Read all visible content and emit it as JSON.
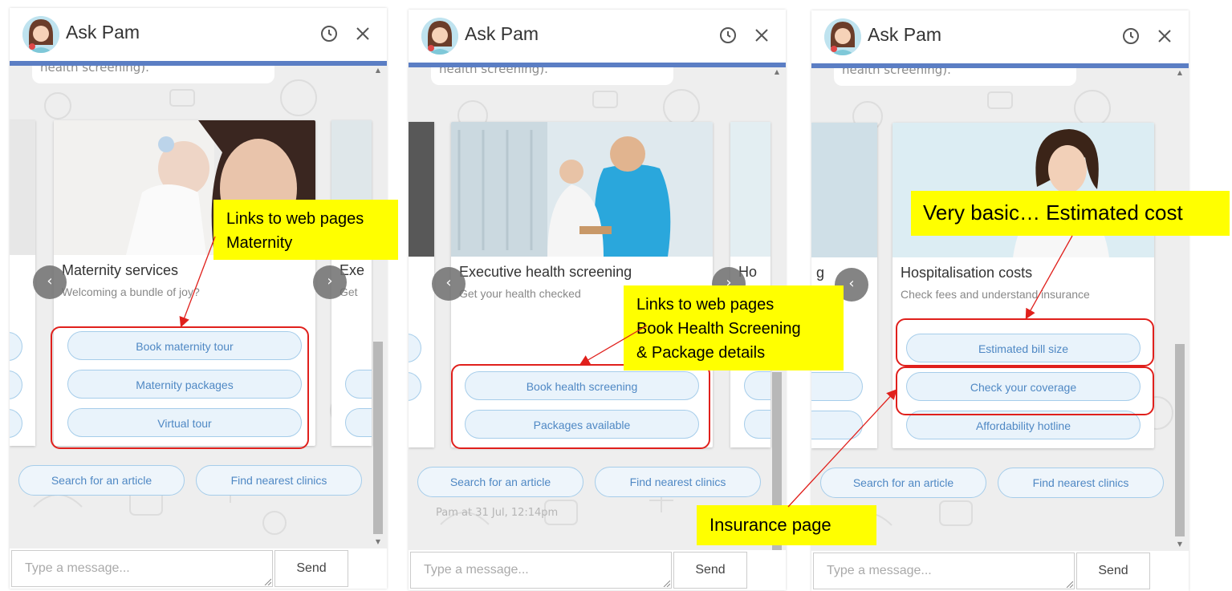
{
  "chat": {
    "title": "Ask Pam",
    "previous_message": "health screening).",
    "input_placeholder": "Type a message...",
    "send_label": "Send",
    "quick_replies": [
      "Search for an article",
      "Find nearest clinics"
    ],
    "timestamp": "Pam at 31 Jul, 12:14pm"
  },
  "panels": [
    {
      "card": {
        "title": "Maternity services",
        "subtitle": "Welcoming a bundle of joy?",
        "buttons": [
          "Book maternity tour",
          "Maternity packages",
          "Virtual tour"
        ]
      },
      "next_card_title": "Exe",
      "next_card_subtitle": "Get"
    },
    {
      "card": {
        "title": "Executive health screening",
        "subtitle": "Get your health checked",
        "buttons": [
          "Book health screening",
          "Packages available"
        ]
      },
      "next_card_title": "Ho"
    },
    {
      "card": {
        "title": "Hospitalisation costs",
        "subtitle": "Check fees and understand insurance",
        "buttons": [
          "Estimated bill size",
          "Check your coverage",
          "Affordability hotline"
        ]
      },
      "prev_card_title": "g"
    }
  ],
  "annotations": {
    "maternity_links": [
      "Links to web pages",
      "Maternity"
    ],
    "screening_links": [
      "Links to web pages",
      "Book Health Screening",
      "& Package details"
    ],
    "estimated_cost": "Very basic… Estimated cost",
    "insurance": "Insurance page"
  },
  "colors": {
    "header_bar": "#5b7ec4",
    "button_text": "#4f88c4",
    "highlight": "#ffff00",
    "annotation_red": "#e0201c"
  }
}
